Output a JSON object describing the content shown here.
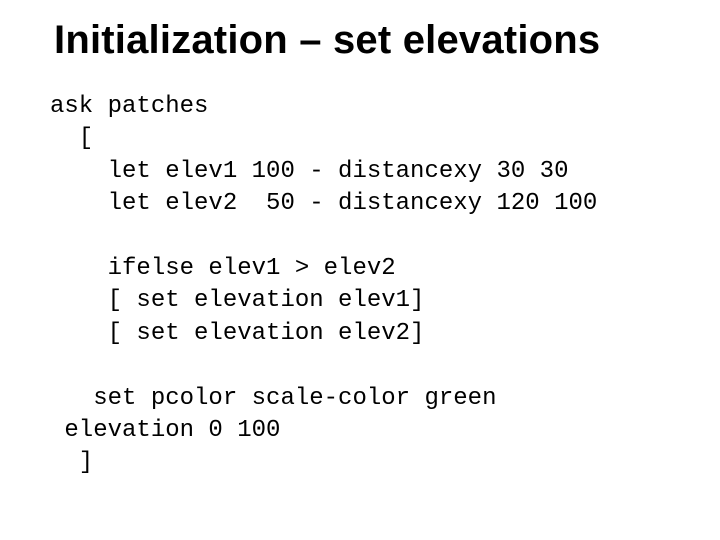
{
  "title": "Initialization – set elevations",
  "code": {
    "l1": "ask patches",
    "l2": "  [",
    "l3": "    let elev1 100 - distancexy 30 30",
    "l4": "    let elev2  50 - distancexy 120 100",
    "l5": "",
    "l6": "    ifelse elev1 > elev2",
    "l7": "    [ set elevation elev1]",
    "l8": "    [ set elevation elev2]",
    "l9": "",
    "l10": "   set pcolor scale-color green",
    "l11": " elevation 0 100",
    "l12": "  ]"
  }
}
